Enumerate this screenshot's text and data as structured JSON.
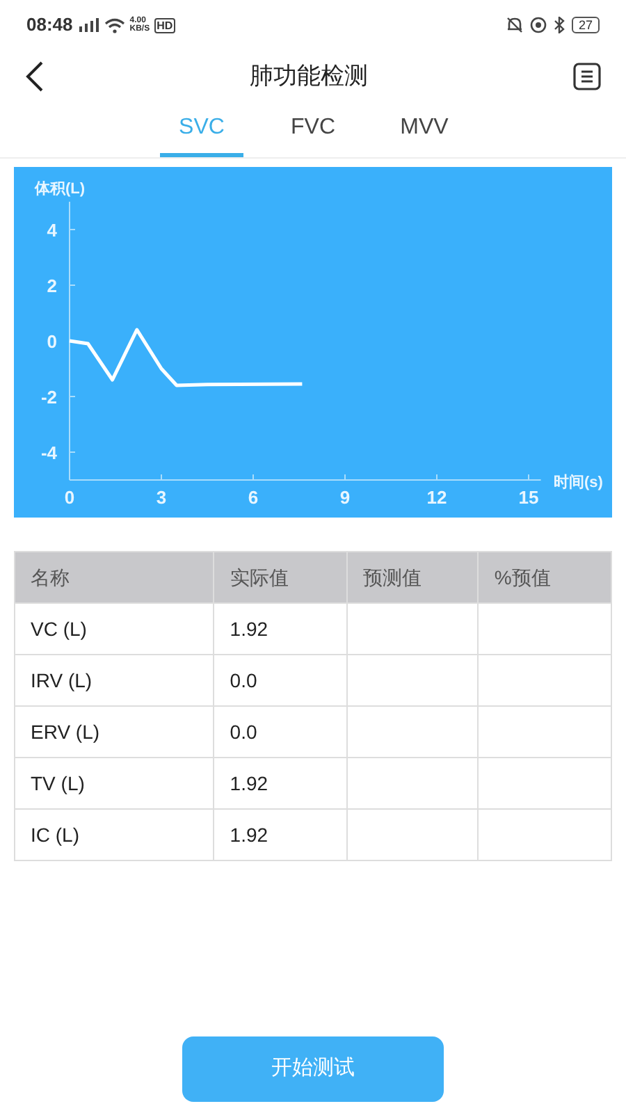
{
  "status_bar": {
    "time": "08:48",
    "net_speed": "4.00",
    "net_unit": "KB/S",
    "hd": "HD",
    "battery": "27"
  },
  "header": {
    "title": "肺功能检测"
  },
  "tabs": [
    {
      "label": "SVC",
      "selected": true
    },
    {
      "label": "FVC",
      "selected": false
    },
    {
      "label": "MVV",
      "selected": false
    }
  ],
  "chart": {
    "chart_data": {
      "type": "line",
      "xlabel": "时间(s)",
      "ylabel": "体积(L)",
      "xlim": [
        0,
        15.4
      ],
      "ylim": [
        -5,
        5
      ],
      "xticks": [
        0,
        3,
        6,
        9,
        12,
        15
      ],
      "yticks": [
        -4,
        -2,
        0,
        2,
        4
      ],
      "x": [
        0,
        0.6,
        1.4,
        2.2,
        3.0,
        3.5,
        4.5,
        7.6
      ],
      "series": [
        {
          "color": "#ffffff",
          "values": [
            0,
            -0.1,
            -1.4,
            0.4,
            -1.0,
            -1.6,
            -1.57,
            -1.55
          ]
        }
      ]
    }
  },
  "table": {
    "columns": [
      "名称",
      "实际值",
      "预测值",
      "%预值"
    ],
    "rows": [
      [
        "VC (L)",
        "1.92",
        "",
        ""
      ],
      [
        "IRV (L)",
        "0.0",
        "",
        ""
      ],
      [
        "ERV (L)",
        "0.0",
        "",
        ""
      ],
      [
        "TV (L)",
        "1.92",
        "",
        ""
      ],
      [
        "IC (L)",
        "1.92",
        "",
        ""
      ]
    ]
  },
  "start_button": "开始测试"
}
